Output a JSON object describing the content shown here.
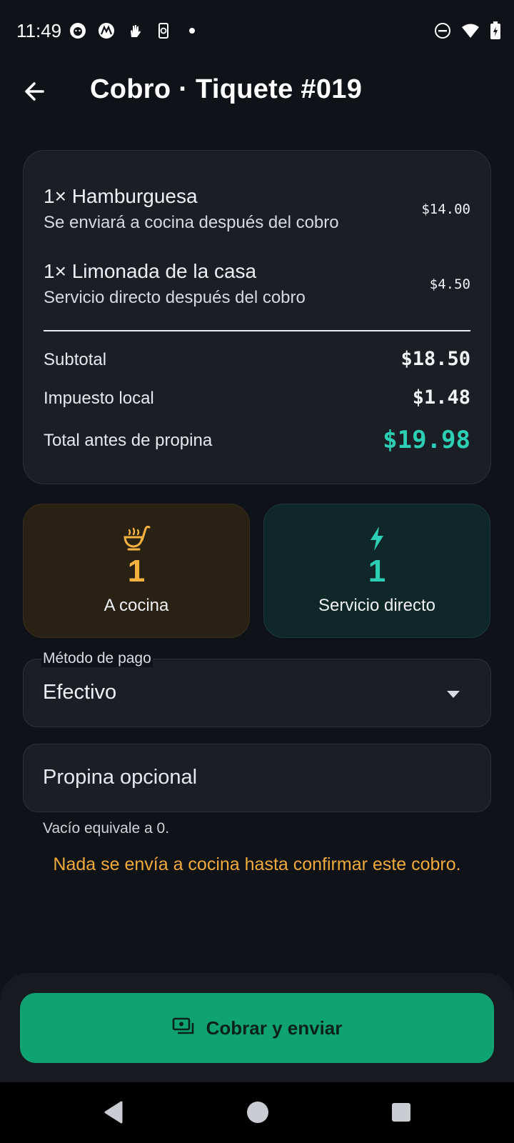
{
  "status_bar": {
    "time": "11:49"
  },
  "header": {
    "title": "Cobro · Tiquete #019"
  },
  "items": [
    {
      "name": "1× Hamburguesa",
      "note": "Se enviará a cocina después del cobro",
      "price": "$14.00"
    },
    {
      "name": "1× Limonada de la casa",
      "note": "Servicio directo después del cobro",
      "price": "$4.50"
    }
  ],
  "summary": {
    "subtotal_label": "Subtotal",
    "subtotal": "$18.50",
    "tax_label": "Impuesto local",
    "tax": "$1.48",
    "total_label": "Total antes de propina",
    "total": "$19.98"
  },
  "stats": {
    "kitchen": {
      "count": "1",
      "label": "A cocina",
      "color": "#f5b23f"
    },
    "direct": {
      "count": "1",
      "label": "Servicio directo",
      "color": "#2ccfb3"
    }
  },
  "payment": {
    "label": "Método de pago",
    "value": "Efectivo"
  },
  "tip": {
    "placeholder": "Propina opcional",
    "helper": "Vacío equivale a 0."
  },
  "warning": "Nada se envía a cocina hasta confirmar este cobro.",
  "action": {
    "label": "Cobrar y enviar"
  }
}
